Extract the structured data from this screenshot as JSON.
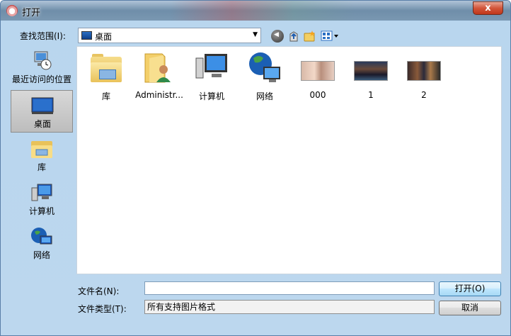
{
  "window": {
    "title": "打开",
    "close_symbol": "x"
  },
  "look_in": {
    "label": "查找范围(I):",
    "value": "桌面"
  },
  "sidebar": {
    "items": [
      {
        "label": "最近访问的位置"
      },
      {
        "label": "桌面"
      },
      {
        "label": "库"
      },
      {
        "label": "计算机"
      },
      {
        "label": "网络"
      }
    ]
  },
  "files": [
    {
      "label": "库"
    },
    {
      "label": "Administr..."
    },
    {
      "label": "计算机"
    },
    {
      "label": "网络"
    },
    {
      "label": "000"
    },
    {
      "label": "1"
    },
    {
      "label": "2"
    }
  ],
  "bottom": {
    "filename_label": "文件名(N):",
    "filename_value": "",
    "filetype_label": "文件类型(T):",
    "filetype_value": "所有支持图片格式",
    "open_button": "打开(O)",
    "cancel_button": "取消"
  },
  "colors": {
    "accent_blue": "#2a6fc4",
    "folder_yellow": "#e2b64b",
    "close_red": "#c0371a"
  }
}
